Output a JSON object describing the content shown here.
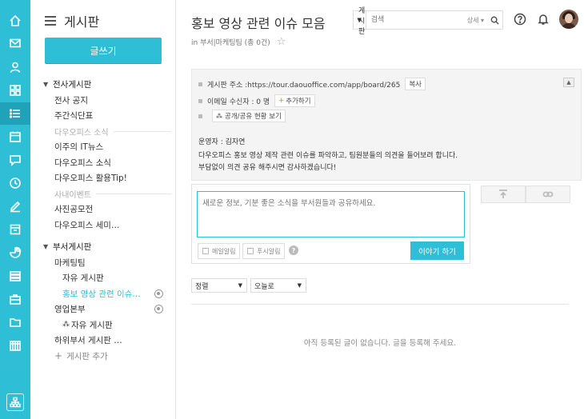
{
  "rail": {
    "icons": [
      "home-icon",
      "mail-icon",
      "user-icon",
      "apps-icon",
      "board-list-icon",
      "calendar-icon",
      "chat-icon",
      "clock-icon",
      "edit-icon",
      "document-icon",
      "chart-icon",
      "stack-icon",
      "briefcase-icon",
      "folder-icon",
      "building-icon"
    ],
    "active_index": 4,
    "bottom_icon": "org-chart-icon",
    "color": "#2ebfd6"
  },
  "sidebar": {
    "title": "게시판",
    "write_label": "글쓰기",
    "tree": [
      {
        "label": "전사게시판",
        "type": "group",
        "caret": "▼"
      },
      {
        "label": "전사 공지",
        "type": "sub"
      },
      {
        "label": "주간식단표",
        "type": "sub"
      },
      {
        "label": "다우오피스 소식",
        "type": "section"
      },
      {
        "label": "이주의 IT뉴스",
        "type": "sub"
      },
      {
        "label": "다우오피스 소식",
        "type": "sub"
      },
      {
        "label": "다우오피스 활용Tip!",
        "type": "sub"
      },
      {
        "label": "사내이벤트",
        "type": "section"
      },
      {
        "label": "사진공모전",
        "type": "sub"
      },
      {
        "label": "다우오피스 세미…",
        "type": "sub"
      },
      {
        "label": "부서게시판",
        "type": "group",
        "caret": "▼"
      },
      {
        "label": "마케팅팀",
        "type": "sub"
      },
      {
        "label": "자유 게시판",
        "type": "sub2"
      },
      {
        "label": "홍보 영상 관련 이슈…",
        "type": "sub2",
        "active": true,
        "gear": true
      },
      {
        "label": "영업본부",
        "type": "sub",
        "gear": true
      },
      {
        "label": "자유 게시판",
        "type": "sub2",
        "prefix": "⁂"
      },
      {
        "label": "하위부서 게시판 …",
        "type": "sub"
      },
      {
        "label": "게시판 추가",
        "type": "add"
      }
    ]
  },
  "header": {
    "title": "홍보 영상 관련 이슈 모음",
    "subtitle": "in 부서|마케팅팀 (총 0건)",
    "search_scope": "게시판",
    "search_placeholder": "검색",
    "search_detail": "상세 ▾"
  },
  "info": {
    "address_label": "게시판 주소 :https://tour.daouoffice.com/app/board/265",
    "copy_label": "복사",
    "email_label": "이메일 수신자 : 0 명",
    "add_label": "추가하기",
    "share_label": "공개/공유 현황 보기",
    "operator": "운영자 : 김자연",
    "desc1": "다우오피스 홍보 영상 제작 관련 이슈를 파악하고, 팀원분들의 의견을 들어보려 합니다.",
    "desc2": "부담없이 의견 공유 해주시면 감사하겠습니다!"
  },
  "composer": {
    "placeholder": "새로운 정보, 기분 좋은 소식을 부서원들과 공유하세요.",
    "notice_label": "메일알림",
    "push_label": "푸시알림",
    "post_label": "이야기 하기"
  },
  "filters": {
    "sort": "정렬",
    "order": "오늘로"
  },
  "empty_text": "아직 등록된 글이 없습니다. 글을 등록해 주세요."
}
